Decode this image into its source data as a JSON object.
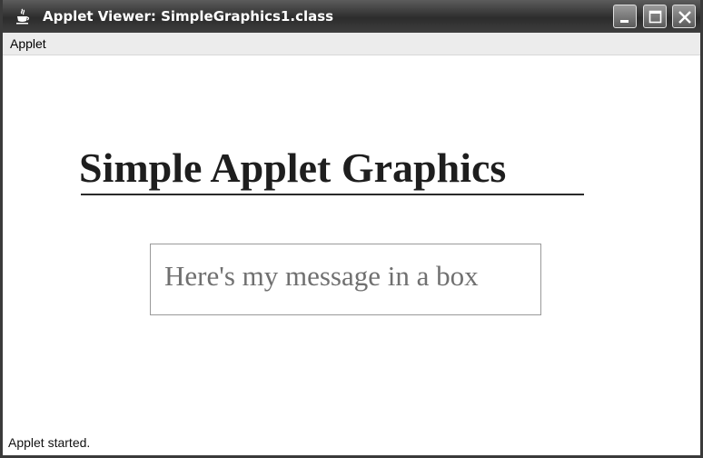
{
  "window": {
    "title": "Applet Viewer: SimpleGraphics1.class",
    "app_icon": "java-cup-icon",
    "controls": [
      "minimize-icon",
      "maximize-icon",
      "close-icon"
    ]
  },
  "menubar": {
    "items": [
      {
        "label": "Applet"
      }
    ]
  },
  "applet": {
    "headline": "Simple Applet Graphics",
    "message": "Here's my message in a box"
  },
  "status": {
    "text": "Applet started."
  },
  "colors": {
    "titlebar": "#2c2c2c",
    "menubar": "#ececec",
    "headline": "#1e1e1e",
    "message": "#707070",
    "box_border": "#9a9a9a"
  }
}
